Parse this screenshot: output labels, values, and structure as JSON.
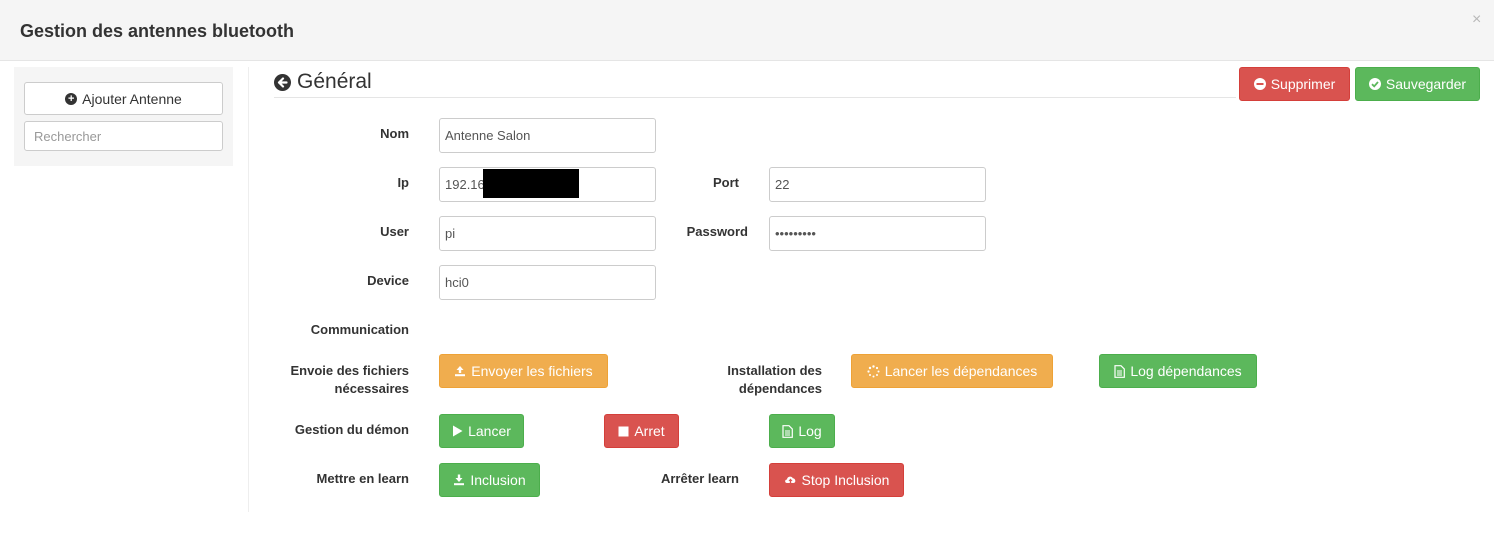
{
  "header": {
    "title": "Gestion des antennes bluetooth",
    "close_glyph": "×"
  },
  "sidebar": {
    "add_button_label": "Ajouter Antenne",
    "search_placeholder": "Rechercher"
  },
  "main": {
    "section_title": "Général",
    "delete_label": "Supprimer",
    "save_label": "Sauvegarder",
    "form": {
      "name_label": "Nom",
      "name_value": "Antenne Salon",
      "ip_label": "Ip",
      "ip_value": "192.16",
      "port_label": "Port",
      "port_value": "22",
      "user_label": "User",
      "user_value": "pi",
      "password_label": "Password",
      "password_value": "123456789",
      "device_label": "Device",
      "device_value": "hci0",
      "communication_label": "Communication"
    },
    "actions": {
      "send_files_label_1": "Envoie des fichiers",
      "send_files_label_2": "nécessaires",
      "send_files_button": "Envoyer les fichiers",
      "install_deps_label_1": "Installation des",
      "install_deps_label_2": "dépendances",
      "launch_deps_button": "Lancer les dépendances",
      "log_deps_button": "Log dépendances",
      "daemon_label": "Gestion du démon",
      "start_button": "Lancer",
      "stop_button": "Arret",
      "log_button": "Log",
      "learn_label": "Mettre en learn",
      "inclusion_button": "Inclusion",
      "stop_learn_label": "Arrêter learn",
      "stop_inclusion_button": "Stop Inclusion"
    }
  },
  "colors": {
    "danger": "#d9534f",
    "success": "#5cb85c",
    "warning": "#f0ad4e"
  },
  "icons": {
    "add": "plus-circle-icon",
    "back": "arrow-circle-left-icon",
    "delete": "minus-circle-icon",
    "save": "check-circle-icon",
    "upload": "upload-icon",
    "spinner": "spinner-icon",
    "file": "file-text-icon",
    "play": "play-icon",
    "stop": "stop-icon",
    "download": "download-icon",
    "cloud_upload": "cloud-upload-icon",
    "close": "close-icon"
  }
}
